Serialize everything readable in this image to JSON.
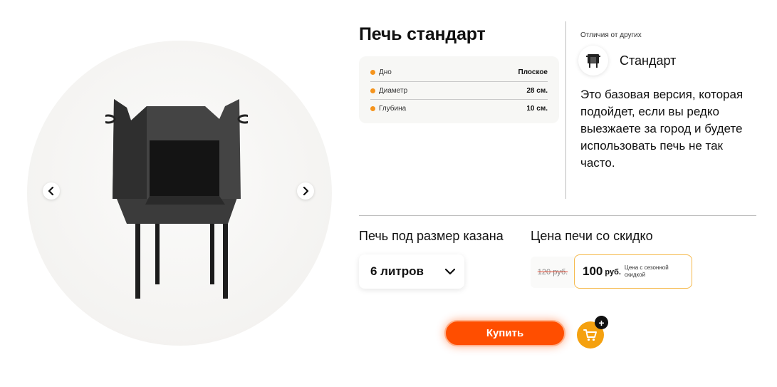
{
  "product": {
    "title": "Печь стандарт",
    "specs": [
      {
        "name": "Дно",
        "value": "Плоское"
      },
      {
        "name": "Диаметр",
        "value": "28 см."
      },
      {
        "name": "Глубина",
        "value": "10 см."
      }
    ]
  },
  "difference": {
    "caption": "Отличия от других",
    "name": "Стандарт",
    "description": "Это базовая версия, которая подойдет, если вы редко выезжаете за город и будете использовать печь не так часто."
  },
  "size": {
    "label": "Печь под размер казана",
    "selected": "6 литров"
  },
  "price": {
    "label": "Цена печи со скидко",
    "old": "120 руб.",
    "new_amount": "100",
    "currency": "руб.",
    "note": "Цена с сезонной скидкой"
  },
  "actions": {
    "buy_label": "Купить",
    "cart_plus": "+"
  },
  "colors": {
    "accent_orange": "#ff4e00",
    "cart_orange": "#f5a10f",
    "dot_orange": "#f5941d",
    "price_border": "#f5b84a"
  },
  "icons": {
    "prev": "chevron-left-icon",
    "next": "chevron-right-icon",
    "select": "chevron-down-icon",
    "cart": "cart-icon",
    "variant": "stove-icon"
  }
}
